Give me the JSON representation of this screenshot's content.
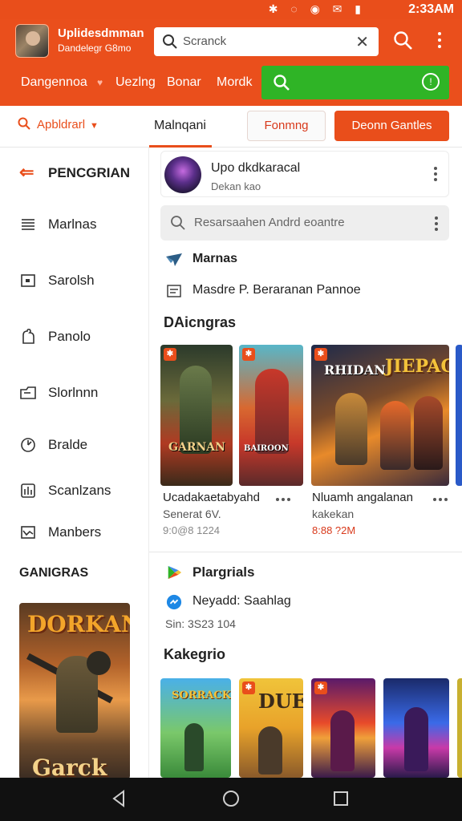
{
  "status_bar": {
    "time": "2:33AM",
    "icons": [
      "bluetooth-icon",
      "vibrate-icon",
      "wifi-icon",
      "mail-icon",
      "signal-icon",
      "battery-icon"
    ]
  },
  "header": {
    "title": "Uplidesdmman",
    "subtitle": "Dandelegr G8mo",
    "search_text": "Scranck",
    "nav": [
      "Dangennoa",
      "Uezlng",
      "Bonar",
      "Mordk"
    ]
  },
  "tabs": {
    "filter_label": "Apbldrarl",
    "active_tab": "Malnqani",
    "outline_button": "Fonmng",
    "filled_button": "Deonn Gantles"
  },
  "sidebar": {
    "header": "PENCGRIAN",
    "items": [
      "Marlnas",
      "Sarolsh",
      "Panolo",
      "Slorlnnn",
      "Bralde",
      "Scanlzans",
      "Manbers"
    ],
    "section_title": "GANIGRAS",
    "poster_title_top": "DORKAN",
    "poster_title_bottom": "Garck"
  },
  "main": {
    "profile": {
      "name": "Upo dkdkaracal",
      "sub": "Dekan kao"
    },
    "search_placeholder": "Resarsaahen Andrd eoantre",
    "section1_title": "Marnas",
    "row1": "Masdre P. Beraranan Pannoe",
    "section2_title": "DAicngras",
    "games": [
      {
        "cover_title": "GARNAN",
        "title": "Ucadakaetabyahd",
        "sub": "Senerat 6V.",
        "meta": "9:0@8 1224"
      },
      {
        "cover_title": "BAIROON",
        "title": "",
        "sub": "",
        "meta": ""
      },
      {
        "cover_title": "RHIDAN",
        "cover_title2": "JIEPAC",
        "title": "Nluamh angalanan",
        "sub": "kakekan",
        "meta": "8:88 ?2M"
      }
    ],
    "section3_title": "Plargrials",
    "row2": "Neyadd: Saahlag",
    "row3": "Sin:   3S23 104",
    "section4_title": "Kakegrio",
    "tile_titles": [
      "SORRACK",
      "DUE"
    ]
  },
  "accent_color": "#e94e1b",
  "green_color": "#2fb426"
}
